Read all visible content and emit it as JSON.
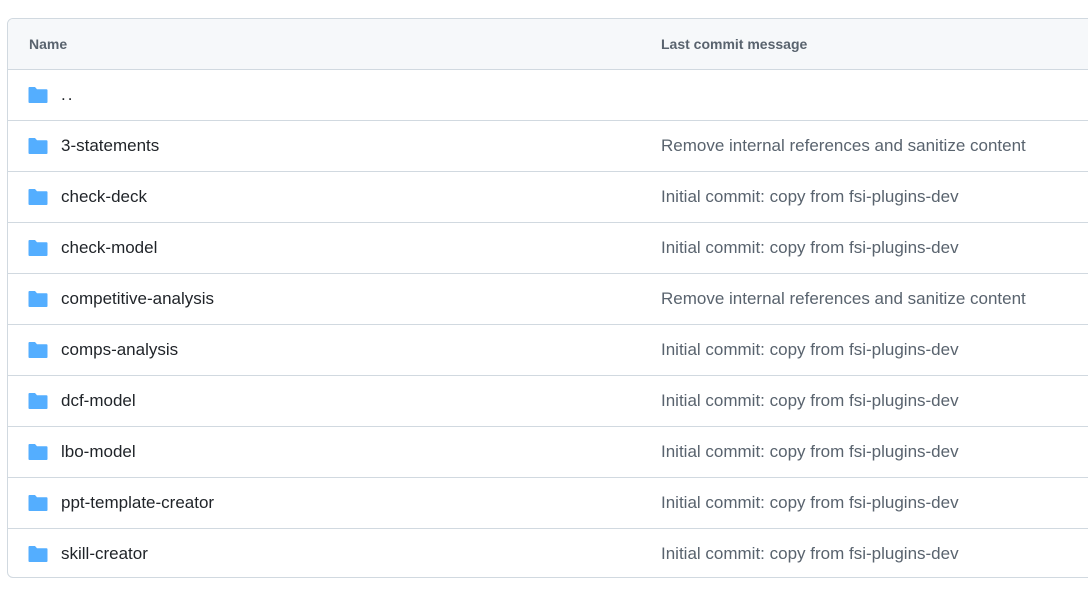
{
  "table": {
    "header": {
      "name_label": "Name",
      "message_label": "Last commit message"
    },
    "parent": {
      "label": ".."
    },
    "rows": [
      {
        "name": "3-statements",
        "message": "Remove internal references and sanitize content"
      },
      {
        "name": "check-deck",
        "message": "Initial commit: copy from fsi-plugins-dev"
      },
      {
        "name": "check-model",
        "message": "Initial commit: copy from fsi-plugins-dev"
      },
      {
        "name": "competitive-analysis",
        "message": "Remove internal references and sanitize content"
      },
      {
        "name": "comps-analysis",
        "message": "Initial commit: copy from fsi-plugins-dev"
      },
      {
        "name": "dcf-model",
        "message": "Initial commit: copy from fsi-plugins-dev"
      },
      {
        "name": "lbo-model",
        "message": "Initial commit: copy from fsi-plugins-dev"
      },
      {
        "name": "ppt-template-creator",
        "message": "Initial commit: copy from fsi-plugins-dev"
      },
      {
        "name": "skill-creator",
        "message": "Initial commit: copy from fsi-plugins-dev"
      }
    ]
  },
  "colors": {
    "folder_icon": "#54aeff",
    "header_bg": "#f6f8fa",
    "border": "#d1d9e0",
    "name_text": "#1f2328",
    "muted_text": "#59636e"
  },
  "icons": {
    "folder": "folder-icon"
  }
}
